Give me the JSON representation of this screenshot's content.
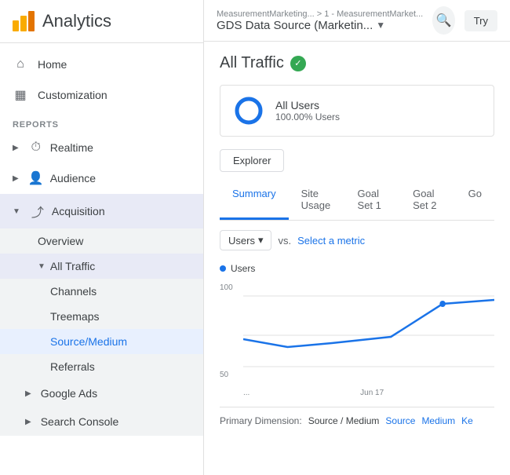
{
  "sidebar": {
    "title": "Analytics",
    "nav": [
      {
        "id": "home",
        "label": "Home",
        "icon": "⌂",
        "type": "item"
      },
      {
        "id": "customization",
        "label": "Customization",
        "icon": "▦",
        "type": "item"
      }
    ],
    "reports_label": "REPORTS",
    "reports_nav": [
      {
        "id": "realtime",
        "label": "Realtime",
        "icon": "🕐",
        "type": "expandable"
      },
      {
        "id": "audience",
        "label": "Audience",
        "icon": "👤",
        "type": "expandable"
      },
      {
        "id": "acquisition",
        "label": "Acquisition",
        "icon": "↗",
        "type": "expandable",
        "expanded": true
      }
    ],
    "acquisition_sub": [
      {
        "id": "overview",
        "label": "Overview"
      },
      {
        "id": "all-traffic",
        "label": "All Traffic",
        "expanded": true
      }
    ],
    "all_traffic_sub": [
      {
        "id": "channels",
        "label": "Channels"
      },
      {
        "id": "treemaps",
        "label": "Treemaps"
      },
      {
        "id": "source-medium",
        "label": "Source/Medium",
        "active": true
      },
      {
        "id": "referrals",
        "label": "Referrals"
      }
    ],
    "bottom_nav": [
      {
        "id": "google-ads",
        "label": "Google Ads",
        "type": "expandable"
      },
      {
        "id": "search-console",
        "label": "Search Console",
        "type": "expandable"
      }
    ]
  },
  "topbar": {
    "breadcrumb": "MeasurementMarketing... > 1 - MeasurementMarket...",
    "data_source": "GDS Data Source (Marketin...",
    "search_label": "🔍",
    "try_label": "Try"
  },
  "report": {
    "title": "All Traffic",
    "verified": "✓",
    "segment": {
      "label": "All Users",
      "sub": "100.00% Users"
    },
    "explorer_tab": "Explorer",
    "tabs": [
      {
        "id": "summary",
        "label": "Summary",
        "active": true
      },
      {
        "id": "site-usage",
        "label": "Site Usage"
      },
      {
        "id": "goal-set-1",
        "label": "Goal Set 1"
      },
      {
        "id": "goal-set-2",
        "label": "Goal Set 2"
      },
      {
        "id": "goal-set-more",
        "label": "Go"
      }
    ],
    "metric_dropdown": "Users",
    "vs_text": "vs.",
    "select_metric": "Select a metric",
    "chart": {
      "legend": "Users",
      "y_labels": [
        "100",
        "50"
      ],
      "x_labels": [
        "...",
        "Jun 17"
      ],
      "data_points": [
        {
          "x": 0,
          "y": 65
        },
        {
          "x": 0.6,
          "y": 58
        },
        {
          "x": 0.85,
          "y": 90
        },
        {
          "x": 1.0,
          "y": 95
        }
      ]
    },
    "primary_dimension": {
      "label": "Primary Dimension:",
      "options": [
        {
          "id": "source-medium",
          "label": "Source / Medium",
          "active": true
        },
        {
          "id": "source",
          "label": "Source",
          "link": true
        },
        {
          "id": "medium",
          "label": "Medium",
          "link": true
        },
        {
          "id": "keyword",
          "label": "Ke",
          "link": true
        }
      ]
    }
  }
}
